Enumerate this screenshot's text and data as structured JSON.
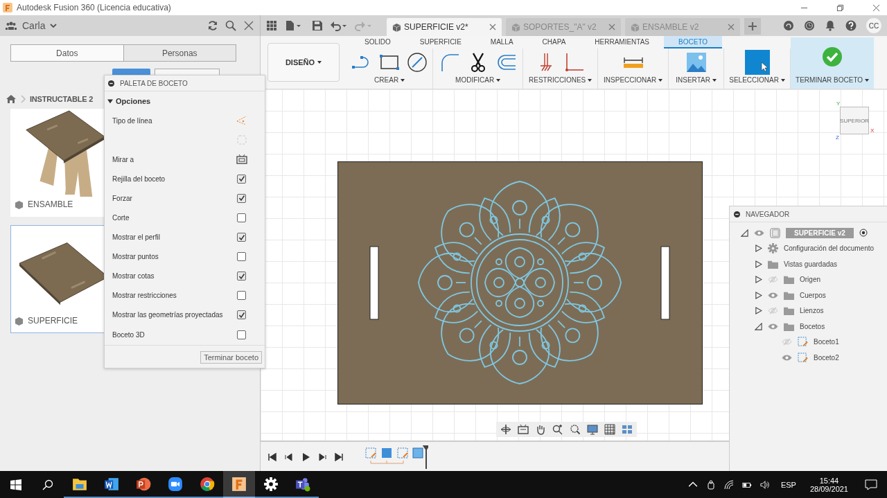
{
  "window": {
    "title": "Autodesk Fusion 360 (Licencia educativa)"
  },
  "data_panel": {
    "user": "Carla",
    "tabs": [
      {
        "label": "Datos",
        "selected": true
      },
      {
        "label": "Personas",
        "selected": false
      }
    ],
    "breadcrumb": "INSTRUCTABLE 2",
    "files": [
      {
        "name": "ENSAMBLE",
        "kind": "stool",
        "selected": false
      },
      {
        "name": "SUPERFICIE",
        "kind": "board",
        "selected": true
      }
    ]
  },
  "document_tabs": [
    {
      "label": "SUPERFICIE v2*",
      "selected": true
    },
    {
      "label": "SOPORTES_\"A\" v2",
      "selected": false
    },
    {
      "label": "ENSAMBLE v2",
      "selected": false
    }
  ],
  "account": {
    "initials": "CC"
  },
  "toolbar": {
    "workspace": "DISEÑO",
    "tabs": [
      {
        "label": "SOLIDO",
        "selected": false
      },
      {
        "label": "SUPERFICIE",
        "selected": false
      },
      {
        "label": "MALLA",
        "selected": false
      },
      {
        "label": "CHAPA",
        "selected": false
      },
      {
        "label": "HERRAMIENTAS",
        "selected": false
      },
      {
        "label": "BOCETO",
        "selected": true
      }
    ],
    "groups": [
      {
        "label": "CREAR",
        "kind": "create"
      },
      {
        "label": "MODIFICAR",
        "kind": "modify"
      },
      {
        "label": "RESTRICCIONES",
        "kind": "constraints"
      },
      {
        "label": "INSPECCIONAR",
        "kind": "inspect"
      },
      {
        "label": "INSERTAR",
        "kind": "insert"
      },
      {
        "label": "SELECCIONAR",
        "kind": "select"
      },
      {
        "label": "TERMINAR BOCETO",
        "kind": "finish"
      }
    ]
  },
  "sketch_palette": {
    "title": "PALETA DE BOCETO",
    "section": "Opciones",
    "expanded": true,
    "options": [
      {
        "label": "Tipo de línea",
        "kind": "linetype"
      },
      {
        "kind": "construction"
      },
      {
        "label": "Mirar a",
        "kind": "look_at"
      },
      {
        "label": "Rejilla del boceto",
        "kind": "checkbox",
        "checked": true
      },
      {
        "label": "Forzar",
        "kind": "checkbox",
        "checked": true
      },
      {
        "label": "Corte",
        "kind": "checkbox",
        "checked": false
      },
      {
        "label": "Mostrar el perfil",
        "kind": "checkbox",
        "checked": true
      },
      {
        "label": "Mostrar puntos",
        "kind": "checkbox",
        "checked": false
      },
      {
        "label": "Mostrar cotas",
        "kind": "checkbox",
        "checked": true
      },
      {
        "label": "Mostrar restricciones",
        "kind": "checkbox",
        "checked": false
      },
      {
        "label": "Mostrar las geometrías proyectadas",
        "kind": "checkbox",
        "checked": true
      },
      {
        "label": "Boceto 3D",
        "kind": "checkbox",
        "checked": false
      }
    ],
    "finish_button": "Terminar boceto"
  },
  "viewcube": {
    "face": "SUPERIOR",
    "x_axis": "X",
    "y_axis": "Y",
    "z_axis": "Z"
  },
  "navigator": {
    "title": "NAVEGADOR",
    "root": {
      "label": "SUPERFICIE v2",
      "kind": "component",
      "selected": true,
      "visible": true,
      "expanded": true,
      "children": [
        {
          "label": "Configuración del documento",
          "kind": "settings",
          "selected": false,
          "expanded": false
        },
        {
          "label": "Vistas guardadas",
          "kind": "folder",
          "selected": false,
          "expanded": false
        },
        {
          "label": "Origen",
          "kind": "folder",
          "selected": false,
          "visible": false,
          "expanded": false
        },
        {
          "label": "Cuerpos",
          "kind": "folder",
          "selected": false,
          "visible": true,
          "expanded": false
        },
        {
          "label": "Lienzos",
          "kind": "folder",
          "selected": false,
          "visible": false,
          "expanded": false
        },
        {
          "label": "Bocetos",
          "kind": "folder",
          "selected": false,
          "visible": true,
          "expanded": true,
          "children": [
            {
              "label": "Boceto1",
              "kind": "sketch",
              "selected": false,
              "visible": false
            },
            {
              "label": "Boceto2",
              "kind": "sketch",
              "selected": false,
              "visible": true
            }
          ]
        }
      ]
    }
  },
  "taskbar": {
    "apps": [
      {
        "kind": "explorer",
        "active": false
      },
      {
        "kind": "word",
        "active": false
      },
      {
        "kind": "powerpoint",
        "active": false
      },
      {
        "kind": "zoom",
        "active": false
      },
      {
        "kind": "chrome",
        "active": false
      },
      {
        "kind": "fusion",
        "active": true
      },
      {
        "kind": "settings",
        "active": false
      },
      {
        "kind": "teams",
        "active": false
      }
    ],
    "language": "ESP",
    "time": "15:44",
    "date": "28/09/2021"
  }
}
